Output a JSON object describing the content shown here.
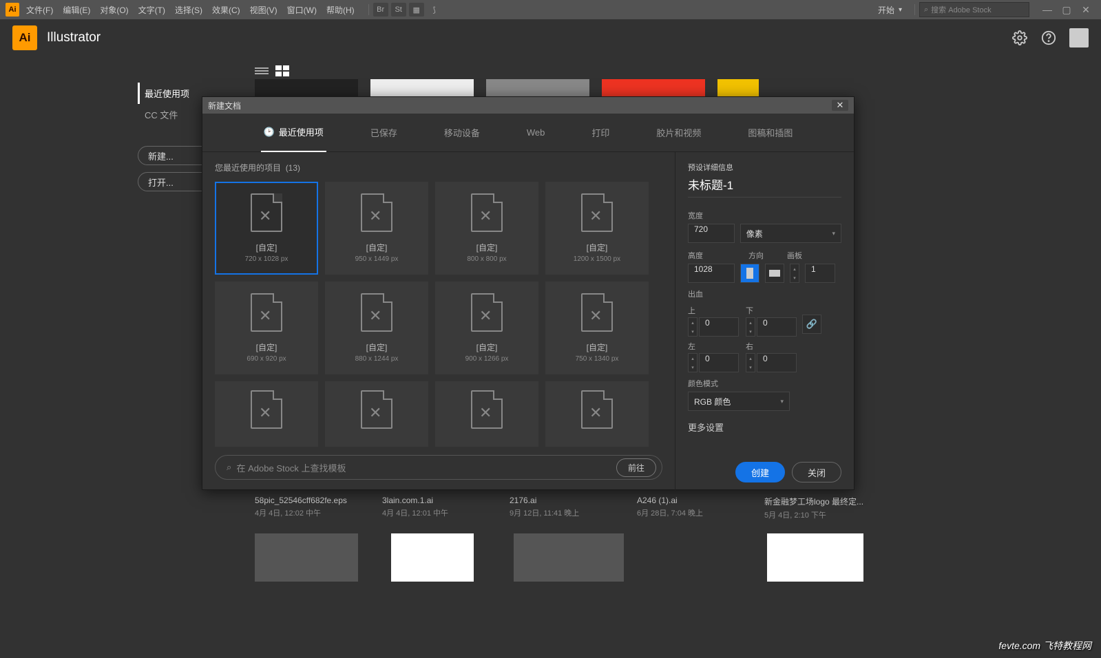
{
  "menubar": {
    "items": [
      "文件(F)",
      "编辑(E)",
      "对象(O)",
      "文字(T)",
      "选择(S)",
      "效果(C)",
      "视图(V)",
      "窗口(W)",
      "帮助(H)"
    ],
    "iconLabels": [
      "Br",
      "St"
    ],
    "start": "开始",
    "searchPlaceholder": "搜索 Adobe Stock"
  },
  "app": {
    "title": "Illustrator",
    "logo": "Ai"
  },
  "leftPanel": {
    "items": [
      "最近使用项",
      "CC 文件"
    ],
    "buttons": [
      "新建...",
      "打开..."
    ]
  },
  "dialog": {
    "title": "新建文档",
    "tabs": [
      "最近使用项",
      "已保存",
      "移动设备",
      "Web",
      "打印",
      "胶片和视频",
      "图稿和插图"
    ],
    "recentHeader": "您最近使用的项目",
    "recentCount": "(13)",
    "presets": [
      {
        "l": "[自定]",
        "d": "720 x 1028 px"
      },
      {
        "l": "[自定]",
        "d": "950 x 1449 px"
      },
      {
        "l": "[自定]",
        "d": "800 x 800 px"
      },
      {
        "l": "[自定]",
        "d": "1200 x 1500 px"
      },
      {
        "l": "[自定]",
        "d": "690 x 920 px"
      },
      {
        "l": "[自定]",
        "d": "880 x 1244 px"
      },
      {
        "l": "[自定]",
        "d": "900 x 1266 px"
      },
      {
        "l": "[自定]",
        "d": "750 x 1340 px"
      }
    ],
    "searchPlaceholder": "在 Adobe Stock 上查找模板",
    "go": "前往",
    "details": {
      "header": "预设详细信息",
      "docTitle": "未标题-1",
      "widthLabel": "宽度",
      "width": "720",
      "unit": "像素",
      "heightLabel": "高度",
      "height": "1028",
      "orientLabel": "方向",
      "artboardLabel": "画板",
      "artboards": "1",
      "bleedLabel": "出血",
      "top": "上",
      "bottom": "下",
      "left": "左",
      "right": "右",
      "bleedTop": "0",
      "bleedBottom": "0",
      "bleedLeft": "0",
      "bleedRight": "0",
      "colorModeLabel": "颜色模式",
      "colorMode": "RGB 颜色",
      "more": "更多设置",
      "create": "创建",
      "close": "关闭"
    }
  },
  "files": [
    {
      "t": "58pic_52546cff682fe.eps",
      "d": "4月 4日, 12:02 中午"
    },
    {
      "t": "3lain.com.1.ai",
      "d": "4月 4日, 12:01 中午"
    },
    {
      "t": "2176.ai",
      "d": "9月 12日, 11:41 晚上"
    },
    {
      "t": "A246 (1).ai",
      "d": "6月 28日, 7:04 晚上"
    },
    {
      "t": "新金融梦工场logo 最终定...",
      "d": "5月 4日, 2:10 下午"
    }
  ],
  "watermark": "fevte.com 飞特教程网"
}
